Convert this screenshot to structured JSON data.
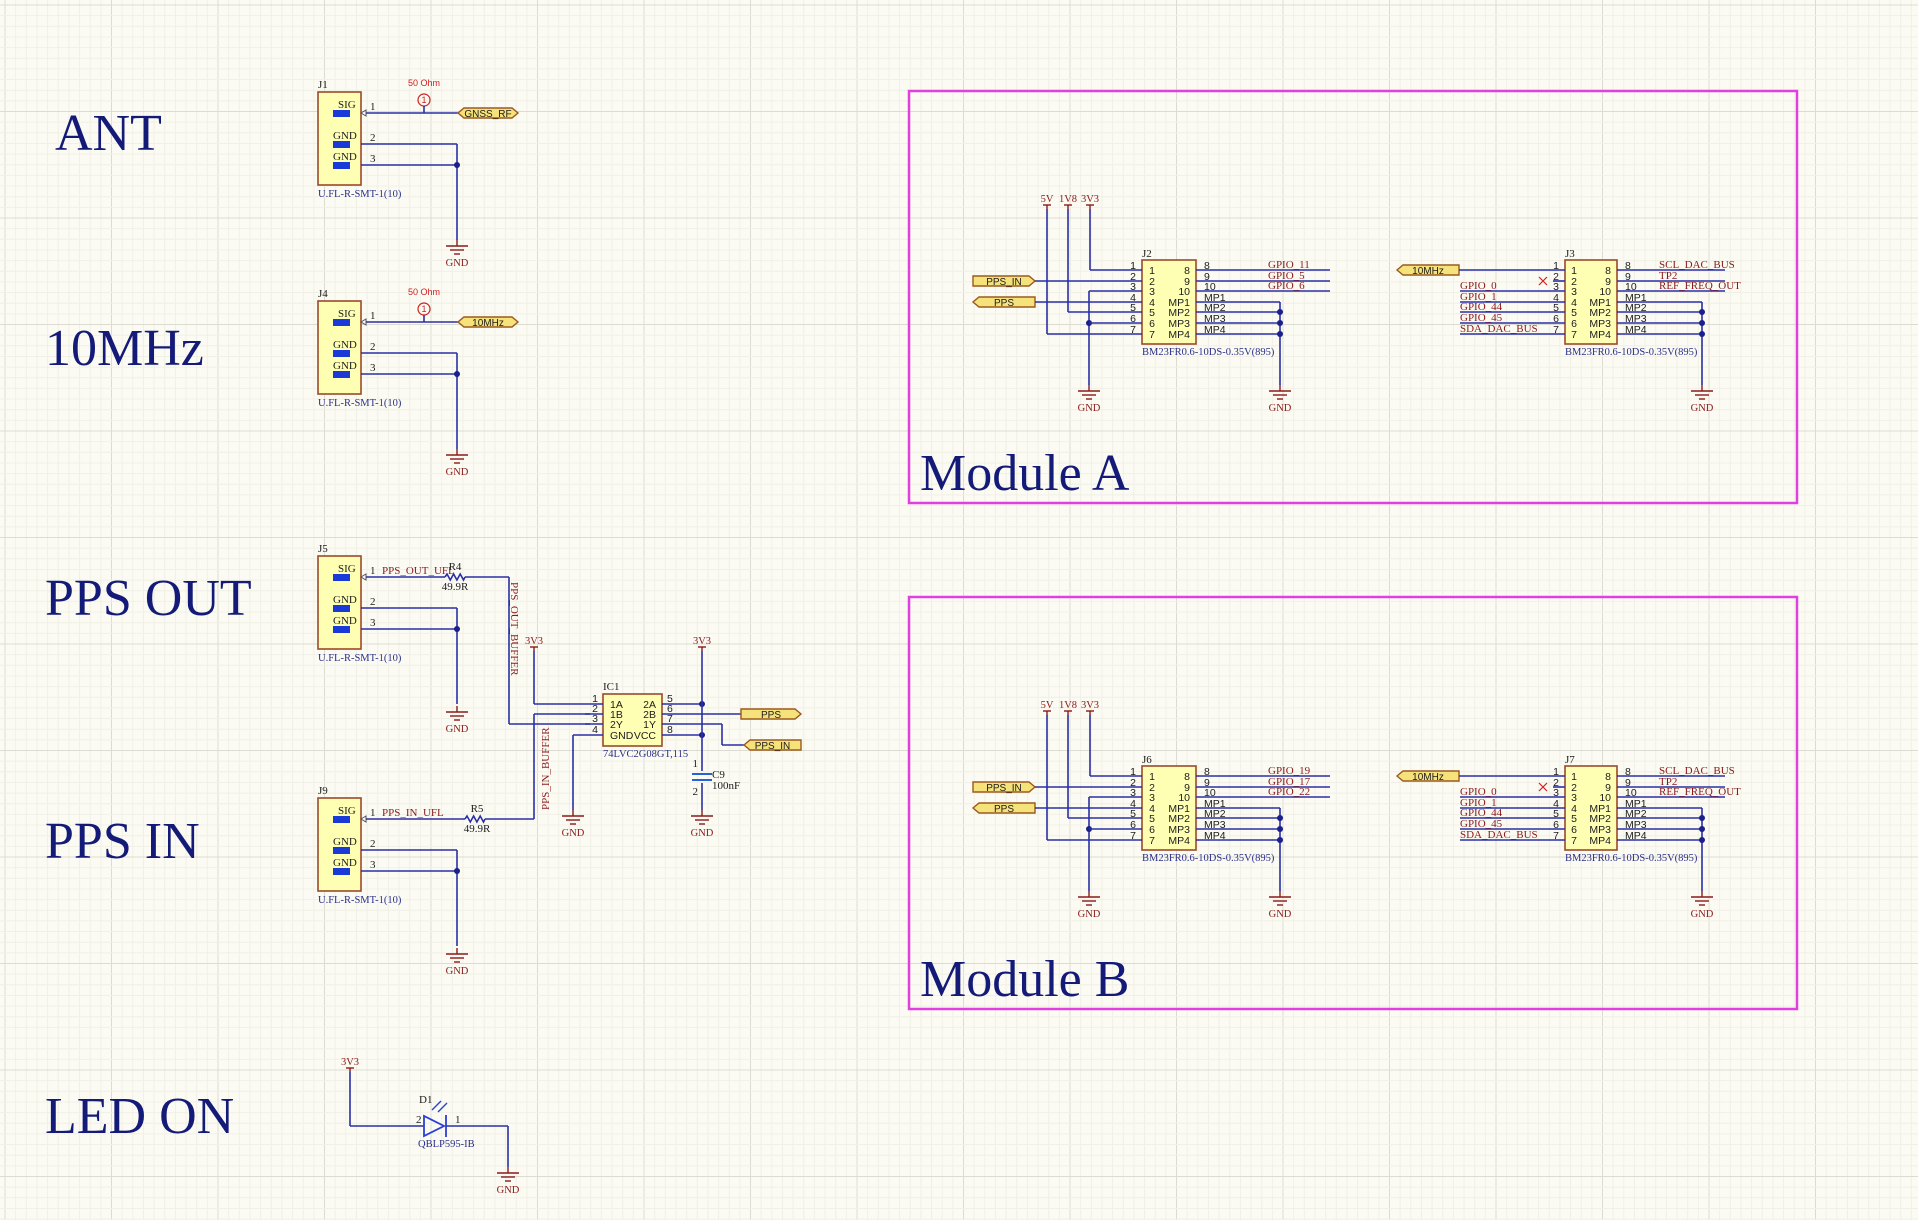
{
  "sections": [
    "ANT",
    "10MHz",
    "PPS OUT",
    "PPS IN",
    "LED ON"
  ],
  "power": {
    "gnd": "GND",
    "v3v3": "3V3",
    "v5": "5V",
    "v1v8": "1V8"
  },
  "connectors": [
    {
      "ref": "J1",
      "part": "U.FL-R-SMT-1(10)",
      "pins": [
        {
          "name": "SIG",
          "num": "1"
        },
        {
          "name": "GND",
          "num": "2"
        },
        {
          "name": "GND",
          "num": "3"
        }
      ],
      "net_port": "GNSS_RF",
      "impedance": "50 Ohm",
      "marker": "1"
    },
    {
      "ref": "J4",
      "part": "U.FL-R-SMT-1(10)",
      "pins": [
        {
          "name": "SIG",
          "num": "1"
        },
        {
          "name": "GND",
          "num": "2"
        },
        {
          "name": "GND",
          "num": "3"
        }
      ],
      "net_port": "10MHz",
      "impedance": "50 Ohm",
      "marker": "1"
    },
    {
      "ref": "J5",
      "part": "U.FL-R-SMT-1(10)",
      "pins": [
        {
          "name": "SIG",
          "num": "1"
        },
        {
          "name": "GND",
          "num": "2"
        },
        {
          "name": "GND",
          "num": "3"
        }
      ],
      "net": "PPS_OUT_UFL",
      "resistor": {
        "ref": "R4",
        "value": "49.9R"
      }
    },
    {
      "ref": "J9",
      "part": "U.FL-R-SMT-1(10)",
      "pins": [
        {
          "name": "SIG",
          "num": "1"
        },
        {
          "name": "GND",
          "num": "2"
        },
        {
          "name": "GND",
          "num": "3"
        }
      ],
      "net": "PPS_IN_UFL",
      "resistor": {
        "ref": "R5",
        "value": "49.9R"
      }
    }
  ],
  "buffer_nets": {
    "out": "PPS_OUT_BUFFER",
    "in": "PPS_IN_BUFFER"
  },
  "ic": {
    "ref": "IC1",
    "part": "74LVC2G08GT,115",
    "left": [
      {
        "num": "1",
        "name": "1A"
      },
      {
        "num": "2",
        "name": "1B"
      },
      {
        "num": "3",
        "name": "2Y"
      },
      {
        "num": "4",
        "name": "GND"
      }
    ],
    "right": [
      {
        "num": "5",
        "name": "2A"
      },
      {
        "num": "6",
        "name": "2B"
      },
      {
        "num": "7",
        "name": "1Y"
      },
      {
        "num": "8",
        "name": "VCC"
      }
    ],
    "ports": {
      "pps": "PPS",
      "pps_in": "PPS_IN"
    }
  },
  "capacitor": {
    "ref": "C9",
    "value": "100nF",
    "pin1": "1",
    "pin2": "2"
  },
  "led": {
    "ref": "D1",
    "part": "QBLP595-IB",
    "pin_a": "2",
    "pin_k": "1"
  },
  "modules": [
    {
      "title": "Module A",
      "left_conn": {
        "ref": "J2",
        "part": "BM23FR0.6-10DS-0.35V(895)",
        "inner_left": [
          "1",
          "2",
          "3",
          "4",
          "5",
          "6",
          "7"
        ],
        "inner_right": [
          "8",
          "9",
          "10",
          "MP1",
          "MP2",
          "MP3",
          "MP4"
        ],
        "gpio": [
          "GPIO_11",
          "GPIO_5",
          "GPIO_6"
        ],
        "ports": [
          "PPS_IN",
          "PPS"
        ]
      },
      "right_conn": {
        "ref": "J3",
        "part": "BM23FR0.6-10DS-0.35V(895)",
        "inner_left": [
          "1",
          "2",
          "3",
          "4",
          "5",
          "6",
          "7"
        ],
        "inner_right": [
          "8",
          "9",
          "10",
          "MP1",
          "MP2",
          "MP3",
          "MP4"
        ],
        "port": "10MHz",
        "left_nets": [
          "GPIO_0",
          "GPIO_1",
          "GPIO_44",
          "GPIO_45",
          "SDA_DAC_BUS"
        ],
        "right_nets": [
          "SCL_DAC_BUS",
          "TP2",
          "REF_FREQ_OUT"
        ]
      }
    },
    {
      "title": "Module B",
      "left_conn": {
        "ref": "J6",
        "part": "BM23FR0.6-10DS-0.35V(895)",
        "inner_left": [
          "1",
          "2",
          "3",
          "4",
          "5",
          "6",
          "7"
        ],
        "inner_right": [
          "8",
          "9",
          "10",
          "MP1",
          "MP2",
          "MP3",
          "MP4"
        ],
        "gpio": [
          "GPIO_19",
          "GPIO_17",
          "GPIO_22"
        ],
        "ports": [
          "PPS_IN",
          "PPS"
        ]
      },
      "right_conn": {
        "ref": "J7",
        "part": "BM23FR0.6-10DS-0.35V(895)",
        "inner_left": [
          "1",
          "2",
          "3",
          "4",
          "5",
          "6",
          "7"
        ],
        "inner_right": [
          "8",
          "9",
          "10",
          "MP1",
          "MP2",
          "MP3",
          "MP4"
        ],
        "port": "10MHz",
        "left_nets": [
          "GPIO_0",
          "GPIO_1",
          "GPIO_44",
          "GPIO_45",
          "SDA_DAC_BUS"
        ],
        "right_nets": [
          "SCL_DAC_BUS",
          "TP2",
          "REF_FREQ_OUT"
        ]
      }
    }
  ],
  "colors": {
    "wire": "#2b2fa6",
    "module_border": "#e040e0",
    "section_label": "#141a78",
    "net_text": "#8a1a1a",
    "component_fill": "#ffffb4"
  }
}
